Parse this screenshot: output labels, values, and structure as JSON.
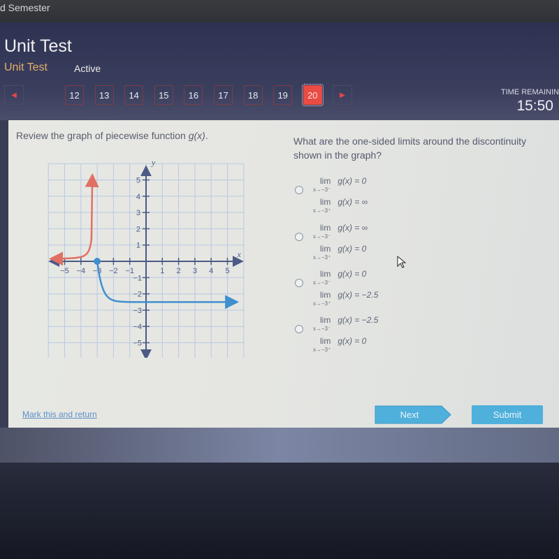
{
  "topbar": {
    "semester_label": "d Semester"
  },
  "header": {
    "title": "Unit Test",
    "subtitle": "Unit Test",
    "status": "Active",
    "question_nav": [
      {
        "label": "12",
        "current": false
      },
      {
        "label": "13",
        "current": false
      },
      {
        "label": "14",
        "current": false
      },
      {
        "label": "15",
        "current": false
      },
      {
        "label": "16",
        "current": false
      },
      {
        "label": "17",
        "current": false
      },
      {
        "label": "18",
        "current": false
      },
      {
        "label": "19",
        "current": false
      },
      {
        "label": "20",
        "current": true
      }
    ],
    "prev_icon": "triangle-left-icon",
    "next_icon": "triangle-right-icon",
    "time_remaining_label": "TIME REMAININ",
    "time_remaining_value": "15:50"
  },
  "question": {
    "prompt_text": "Review the graph of piecewise function ",
    "prompt_func": "g(x)",
    "prompt_end": ".",
    "text": "What are the one-sided limits around the discontinuity shown in the graph?",
    "choices": [
      {
        "left_label": "lim",
        "left_expr": "g(x) = 0",
        "left_sub": "x→−3⁻",
        "right_label": "lim",
        "right_expr": "g(x) = ∞",
        "right_sub": "x→−3⁺"
      },
      {
        "left_label": "lim",
        "left_expr": "g(x) = ∞",
        "left_sub": "x→−3⁻",
        "right_label": "lim",
        "right_expr": "g(x) = 0",
        "right_sub": "x→−3⁺"
      },
      {
        "left_label": "lim",
        "left_expr": "g(x) = 0",
        "left_sub": "x→−3⁻",
        "right_label": "lim",
        "right_expr": "g(x) = −2.5",
        "right_sub": "x→−3⁺"
      },
      {
        "left_label": "lim",
        "left_expr": "g(x) = −2.5",
        "left_sub": "x→−3⁻",
        "right_label": "lim",
        "right_expr": "g(x) = 0",
        "right_sub": "x→−3⁺"
      }
    ]
  },
  "graph": {
    "x_label": "x",
    "y_label": "y",
    "x_ticks": [
      "−5",
      "−4",
      "−3",
      "−2",
      "−1",
      "1",
      "2",
      "3",
      "4",
      "5"
    ],
    "y_ticks_pos": [
      "1",
      "2",
      "3",
      "4",
      "5"
    ],
    "y_ticks_neg": [
      "−1",
      "−2",
      "−3",
      "−4",
      "−5"
    ],
    "colors": {
      "grid": "#b9c8e4",
      "axis": "#4b5a86",
      "left_piece": "#e07064",
      "right_piece": "#3f8fcf"
    },
    "left_piece": {
      "description": "curve from left approaching y=0 as x→-∞, rising to +∞ as x→-3⁻",
      "domain_max": -3
    },
    "right_piece": {
      "description": "starts at closed point (-3, 0), drops and levels toward y=-2.5",
      "start_point": [
        -3,
        0
      ],
      "asymptote_y": -2.5
    }
  },
  "footer": {
    "mark_link": "Mark this and return",
    "next_label": "Next",
    "submit_label": "Submit"
  }
}
